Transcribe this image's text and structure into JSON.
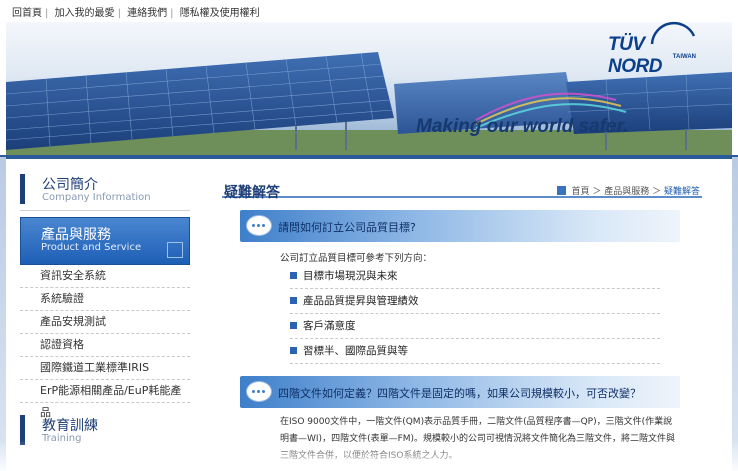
{
  "top_links": [
    "回首頁",
    "加入我的最愛",
    "連絡我們",
    "隱私權及使用權利"
  ],
  "logo": {
    "word": "TÜV NORD",
    "sub": "TAIWAN"
  },
  "banner": {
    "tagline": "Making our world safer."
  },
  "sidebar": {
    "company": {
      "zh": "公司簡介",
      "en": "Company Information"
    },
    "products": {
      "zh": "產品與服務",
      "en": "Product and Service"
    },
    "items": [
      "資訊安全系統",
      "系統驗證",
      "產品安規測試",
      "認證資格",
      "國際鐵道工業標準IRIS",
      "ErP能源相關產品/EuP耗能產品"
    ],
    "training": {
      "zh": "教育訓練",
      "en": "Training"
    }
  },
  "main": {
    "title": "疑難解答",
    "breadcrumb": {
      "home": "首頁",
      "section": "產品與服務",
      "current": "疑難解答"
    },
    "q1": {
      "question": "請問如何訂立公司品質目標?",
      "intro": "公司訂立品質目標可參考下列方向：",
      "points": [
        "目標市場現況與未來",
        "產品品質提昇與管理績效",
        "客戶滿意度",
        "習標半、國際品質與等"
      ]
    },
    "q2": {
      "question": "四階文件如何定義？四階文件是固定的嗎，如果公司規模較小，可否改變？",
      "answer": "在ISO 9000文件中，一階文件(QM)表示品質手冊，二階文件(品質程序書—QP)，三階文件(作業說明書—WI)，四階文件(表單—FM)。規模較小的公司可視情況將文件簡化為三階文件，將二階文件與三階文件合併，以便於符合ISO系統之人力。"
    }
  }
}
